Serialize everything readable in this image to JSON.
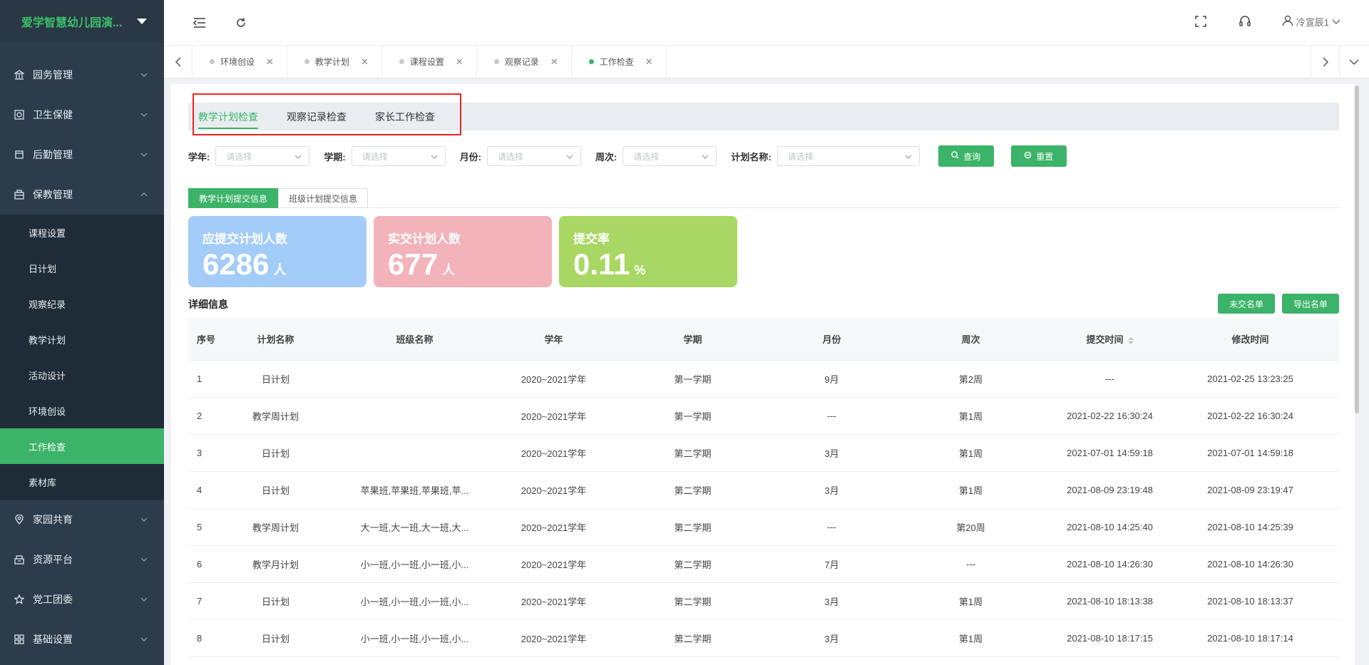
{
  "sidebar": {
    "brand": "爱学智慧幼儿园演...",
    "menus": [
      {
        "label": "园务管理",
        "icon": "building-icon"
      },
      {
        "label": "卫生保健",
        "icon": "health-icon"
      },
      {
        "label": "后勤管理",
        "icon": "logistics-icon"
      },
      {
        "label": "保教管理",
        "icon": "education-icon"
      }
    ],
    "sub_items": [
      "课程设置",
      "日计划",
      "观察纪录",
      "教学计划",
      "活动设计",
      "环境创设",
      "工作检查",
      "素材库"
    ],
    "active_sub": "工作检查",
    "menus_after": [
      {
        "label": "家园共育",
        "icon": "location-icon"
      },
      {
        "label": "资源平台",
        "icon": "box-icon"
      },
      {
        "label": "党工团委",
        "icon": "star-icon"
      },
      {
        "label": "基础设置",
        "icon": "grid-icon"
      }
    ]
  },
  "header": {
    "user": "冷宣辰1"
  },
  "tabs": [
    {
      "label": "环境创设",
      "active": false
    },
    {
      "label": "教学计划",
      "active": false
    },
    {
      "label": "课程设置",
      "active": false
    },
    {
      "label": "观察记录",
      "active": false
    },
    {
      "label": "工作检查",
      "active": true
    }
  ],
  "check_tabs": [
    "教学计划检查",
    "观察记录检查",
    "家长工作检查"
  ],
  "filters": {
    "year_label": "学年:",
    "term_label": "学期:",
    "month_label": "月份:",
    "week_label": "周次:",
    "plan_label": "计划名称:",
    "placeholder": "请选择",
    "query_btn": "查询",
    "reset_btn": "重置"
  },
  "info_tabs": [
    "教学计划提交信息",
    "班级计划提交信息"
  ],
  "stats": [
    {
      "title": "应提交计划人数",
      "value": "6286",
      "unit": "人",
      "color": "#a3cdf8"
    },
    {
      "title": "实交计划人数",
      "value": "677",
      "unit": "人",
      "color": "#f2b3bb"
    },
    {
      "title": "提交率",
      "value": "0.11",
      "unit": "%",
      "color": "#a9d763"
    }
  ],
  "detail": {
    "title": "详细信息",
    "btn_unsubmitted": "未交名单",
    "btn_export": "导出名单"
  },
  "table": {
    "headers": [
      "序号",
      "计划名称",
      "班级名称",
      "学年",
      "学期",
      "月份",
      "周次",
      "提交时间",
      "修改时间"
    ],
    "rows": [
      [
        "1",
        "日计划",
        "",
        "2020~2021学年",
        "第一学期",
        "9月",
        "第2周",
        "---",
        "2021-02-25 13:23:25"
      ],
      [
        "2",
        "教学周计划",
        "",
        "2020~2021学年",
        "第一学期",
        "---",
        "第1周",
        "2021-02-22 16:30:24",
        "2021-02-22 16:30:24"
      ],
      [
        "3",
        "日计划",
        "",
        "2020~2021学年",
        "第二学期",
        "3月",
        "第1周",
        "2021-07-01 14:59:18",
        "2021-07-01 14:59:18"
      ],
      [
        "4",
        "日计划",
        "苹果班,苹果班,苹果班,苹...",
        "2020~2021学年",
        "第二学期",
        "3月",
        "第1周",
        "2021-08-09 23:19:48",
        "2021-08-09 23:19:47"
      ],
      [
        "5",
        "教学周计划",
        "大一班,大一班,大一班,大...",
        "2020~2021学年",
        "第二学期",
        "---",
        "第20周",
        "2021-08-10 14:25:40",
        "2021-08-10 14:25:39"
      ],
      [
        "6",
        "教学月计划",
        "小一班,小一班,小一班,小...",
        "2020~2021学年",
        "第二学期",
        "7月",
        "---",
        "2021-08-10 14:26:30",
        "2021-08-10 14:26:30"
      ],
      [
        "7",
        "日计划",
        "小一班,小一班,小一班,小...",
        "2020~2021学年",
        "第二学期",
        "3月",
        "第1周",
        "2021-08-10 18:13:38",
        "2021-08-10 18:13:37"
      ],
      [
        "8",
        "日计划",
        "小一班,小一班,小一班,小...",
        "2020~2021学年",
        "第二学期",
        "3月",
        "第1周",
        "2021-08-10 18:17:15",
        "2021-08-10 18:17:14"
      ]
    ]
  }
}
